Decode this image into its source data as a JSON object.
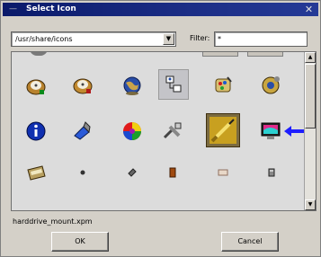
{
  "window": {
    "title": "Select Icon",
    "menu_icon": "menu-icon",
    "close_icon": "close-icon"
  },
  "path_combo": {
    "value": "/usr/share/icons",
    "dropdown_icon": "chevron-down-icon"
  },
  "filter": {
    "label": "Filter:",
    "value": "*"
  },
  "icons": [
    {
      "name": "harddrive-icon"
    },
    {
      "name": "harddrive-mount-icon"
    },
    {
      "name": "globe-icon"
    },
    {
      "name": "network-icon"
    },
    {
      "name": "palette-icon"
    },
    {
      "name": "settings-icon"
    },
    {
      "name": "info-icon"
    },
    {
      "name": "pen-icon"
    },
    {
      "name": "color-wheel-icon"
    },
    {
      "name": "tools-icon"
    },
    {
      "name": "screwdriver-icon"
    },
    {
      "name": "monitor-icon"
    },
    {
      "name": "scanner-icon"
    },
    {
      "name": "small-dot-icon"
    },
    {
      "name": "small-drive-icon"
    },
    {
      "name": "small-book-icon"
    },
    {
      "name": "small-box-icon"
    },
    {
      "name": "small-device-icon"
    }
  ],
  "annotation": {
    "name": "arrow-left-icon",
    "color": "#1e1eff"
  },
  "selected_file": "harddrive_mount.xpm",
  "buttons": {
    "ok": "OK",
    "cancel": "Cancel"
  },
  "colors": {
    "titlebar": "#0a1a6a",
    "dialog": "#d4d0c8",
    "pane": "#dcdcdc",
    "arrow": "#1e1eff"
  }
}
